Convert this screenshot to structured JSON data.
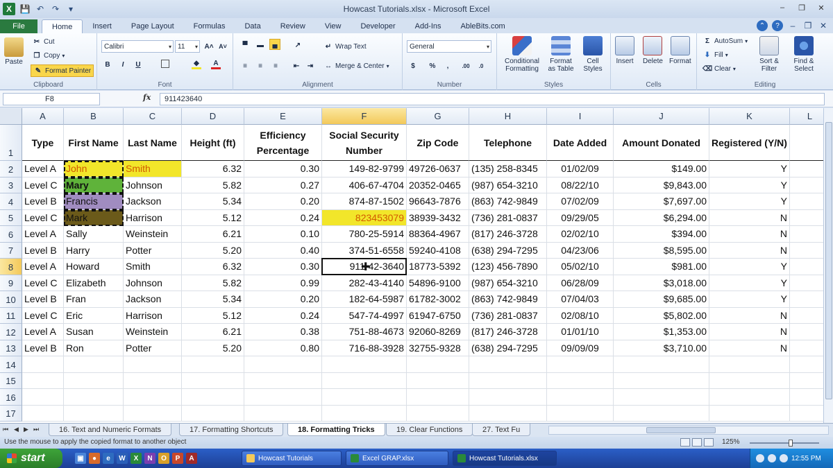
{
  "window": {
    "title": "Howcast Tutorials.xlsx - Microsoft Excel"
  },
  "ribbon_tabs": [
    "File",
    "Home",
    "Insert",
    "Page Layout",
    "Formulas",
    "Data",
    "Review",
    "View",
    "Developer",
    "Add-Ins",
    "AbleBits.com"
  ],
  "clipboard": {
    "paste": "Paste",
    "cut": "Cut",
    "copy": "Copy",
    "format_painter": "Format Painter",
    "label": "Clipboard"
  },
  "font": {
    "name": "Calibri",
    "size": "11",
    "label": "Font"
  },
  "alignment": {
    "wrap": "Wrap Text",
    "merge": "Merge & Center",
    "label": "Alignment"
  },
  "number": {
    "format": "General",
    "label": "Number"
  },
  "styles": {
    "conditional": "Conditional Formatting",
    "format_table": "Format as Table",
    "cell_styles": "Cell Styles",
    "label": "Styles"
  },
  "cells": {
    "insert": "Insert",
    "delete": "Delete",
    "format": "Format",
    "label": "Cells"
  },
  "editing": {
    "autosum": "AutoSum",
    "fill": "Fill",
    "clear": "Clear",
    "sort": "Sort & Filter",
    "find": "Find & Select",
    "label": "Editing"
  },
  "formula_bar": {
    "name_box": "F8",
    "fx": "fx",
    "value": "911423640"
  },
  "columns": [
    "A",
    "B",
    "C",
    "D",
    "E",
    "F",
    "G",
    "H",
    "I",
    "J",
    "K",
    "L"
  ],
  "header_row": [
    "Type",
    "First Name",
    "Last Name",
    "Height (ft)",
    "Efficiency Percentage",
    "Social Security Number",
    "Zip Code",
    "Telephone",
    "Date Added",
    "Amount Donated",
    "Registered (Y/N)"
  ],
  "rows": [
    [
      "Level A",
      "John",
      "Smith",
      "6.32",
      "0.30",
      "149-82-9799",
      "49726-0637",
      "(135) 258-8345",
      "01/02/09",
      "$149.00",
      "Y"
    ],
    [
      "Level C",
      "Mary",
      "Johnson",
      "5.82",
      "0.27",
      "406-67-4704",
      "20352-0465",
      "(987) 654-3210",
      "08/22/10",
      "$9,843.00",
      "Y"
    ],
    [
      "Level B",
      "Francis",
      "Jackson",
      "5.34",
      "0.20",
      "874-87-1502",
      "96643-7876",
      "(863) 742-9849",
      "07/02/09",
      "$7,697.00",
      "Y"
    ],
    [
      "Level C",
      "Mark",
      "Harrison",
      "5.12",
      "0.24",
      "823453079",
      "38939-3432",
      "(736) 281-0837",
      "09/29/05",
      "$6,294.00",
      "N"
    ],
    [
      "Level A",
      "Sally",
      "Weinstein",
      "6.21",
      "0.10",
      "780-25-5914",
      "88364-4967",
      "(817) 246-3728",
      "02/02/10",
      "$394.00",
      "N"
    ],
    [
      "Level B",
      "Harry",
      "Potter",
      "5.20",
      "0.40",
      "374-51-6558",
      "59240-4108",
      "(638) 294-7295",
      "04/23/06",
      "$8,595.00",
      "N"
    ],
    [
      "Level A",
      "Howard",
      "Smith",
      "6.32",
      "0.30",
      "911-42-3640",
      "18773-5392",
      "(123) 456-7890",
      "05/02/10",
      "$981.00",
      "Y"
    ],
    [
      "Level C",
      "Elizabeth",
      "Johnson",
      "5.82",
      "0.99",
      "282-43-4140",
      "54896-9100",
      "(987) 654-3210",
      "06/28/09",
      "$3,018.00",
      "Y"
    ],
    [
      "Level B",
      "Fran",
      "Jackson",
      "5.34",
      "0.20",
      "182-64-5987",
      "61782-3002",
      "(863) 742-9849",
      "07/04/03",
      "$9,685.00",
      "Y"
    ],
    [
      "Level C",
      "Eric",
      "Harrison",
      "5.12",
      "0.24",
      "547-74-4997",
      "61947-6750",
      "(736) 281-0837",
      "02/08/10",
      "$5,802.00",
      "N"
    ],
    [
      "Level A",
      "Susan",
      "Weinstein",
      "6.21",
      "0.38",
      "751-88-4673",
      "92060-8269",
      "(817) 246-3728",
      "01/01/10",
      "$1,353.00",
      "N"
    ],
    [
      "Level B",
      "Ron",
      "Potter",
      "5.20",
      "0.80",
      "716-88-3928",
      "32755-9328",
      "(638) 294-7295",
      "09/09/09",
      "$3,710.00",
      "N"
    ]
  ],
  "row_numbers": [
    "1",
    "2",
    "3",
    "4",
    "5",
    "6",
    "7",
    "8",
    "9",
    "10",
    "11",
    "12",
    "13",
    "14",
    "15",
    "16",
    "17"
  ],
  "sheet_tabs": [
    "16. Text and Numeric Formats",
    "17. Formatting Shortcuts",
    "18. Formatting Tricks",
    "19. Clear Functions",
    "27. Text Fu"
  ],
  "active_sheet": "18. Formatting Tricks",
  "status": {
    "message": "Use the mouse to apply the copied format to another object",
    "zoom": "125%"
  },
  "taskbar": {
    "start": "start",
    "apps": [
      "Howcast Tutorials",
      "Excel GRAP.xlsx",
      "Howcast Tutorials.xlsx"
    ],
    "clock": "12:55 PM",
    "quick_letters": [
      "W",
      "X",
      "N",
      "O",
      "P",
      "A"
    ]
  },
  "colors": {
    "selection": "#f3c95a",
    "yellow_fill": "#f2e62a",
    "green_fill": "#5fb33a",
    "purple_fill": "#a08cc0",
    "olive_fill": "#6b5a1a",
    "ribbon_green": "#2a7a3f"
  }
}
